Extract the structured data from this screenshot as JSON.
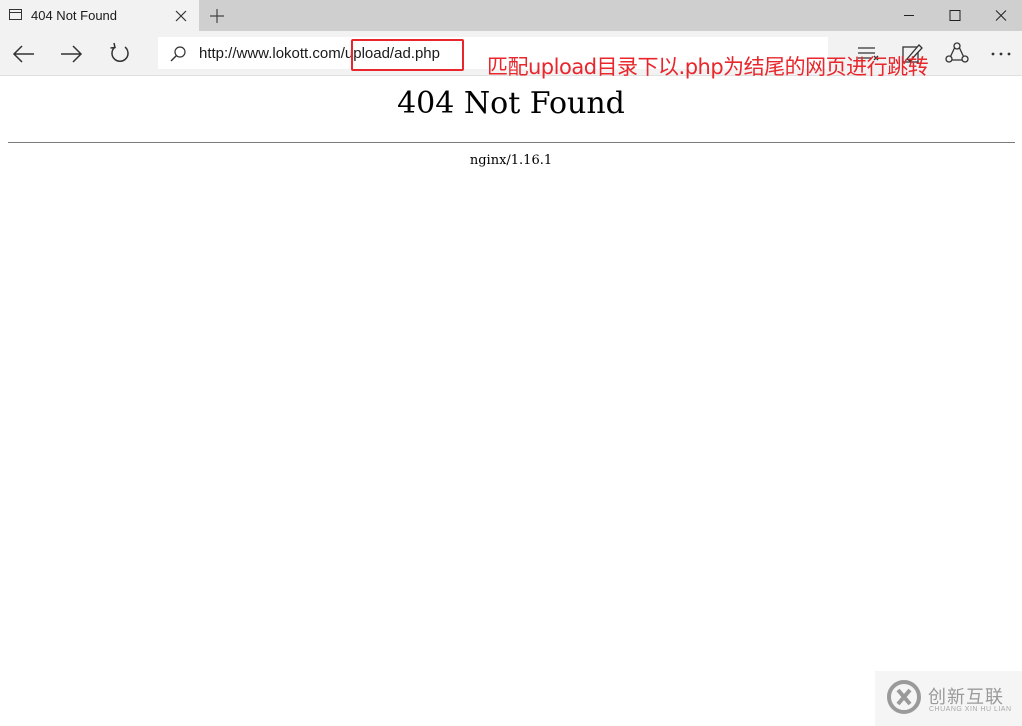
{
  "tab": {
    "title": "404 Not Found"
  },
  "address": {
    "url_base": "http://www.lokott.com/",
    "url_path": "upload/ad.php"
  },
  "annotation": {
    "text": "匹配upload目录下以.php为结尾的网页进行跳转",
    "color": "#e8262b"
  },
  "page": {
    "heading": "404 Not Found",
    "server": "nginx/1.16.1"
  },
  "watermark": {
    "brand_cn": "创新互联",
    "brand_en": "CHUANG XIN HU LIAN"
  },
  "icons": {
    "tab": "tab-page-icon",
    "close": "close-icon",
    "new_tab": "plus-icon",
    "minimize": "minimize-icon",
    "maximize": "maximize-icon",
    "window_close": "close-icon",
    "back": "arrow-left-icon",
    "forward": "arrow-right-icon",
    "refresh": "refresh-icon",
    "search": "search-icon",
    "hub": "hub-icon",
    "note": "web-note-icon",
    "share": "share-icon",
    "more": "more-icon"
  }
}
